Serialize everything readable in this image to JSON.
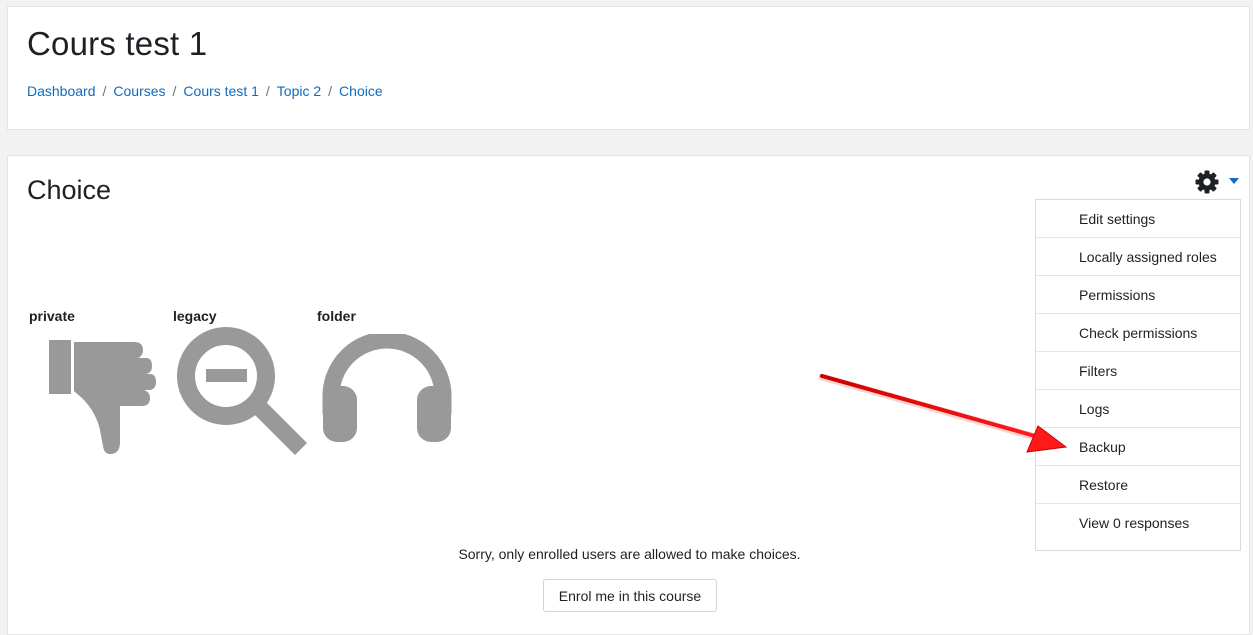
{
  "header": {
    "title": "Cours test 1",
    "breadcrumb": [
      "Dashboard",
      "Courses",
      "Cours test 1",
      "Topic 2",
      "Choice"
    ],
    "separator": "/"
  },
  "activity": {
    "title": "Choice",
    "options": [
      {
        "label": "private",
        "icon": "thumbs-down-icon"
      },
      {
        "label": "legacy",
        "icon": "zoom-out-icon"
      },
      {
        "label": "folder",
        "icon": "headphones-icon"
      }
    ],
    "message": "Sorry, only enrolled users are allowed to make choices.",
    "enrol_button": "Enrol me in this course"
  },
  "settings_menu": {
    "toggle_icon": "gear-icon",
    "items": [
      "Edit settings",
      "Locally assigned roles",
      "Permissions",
      "Check permissions",
      "Filters",
      "Logs",
      "Backup",
      "Restore",
      "View 0 responses"
    ]
  },
  "colors": {
    "link": "#0f6cbf",
    "icon_gray": "#999999",
    "annotation_arrow": "#e60000"
  }
}
